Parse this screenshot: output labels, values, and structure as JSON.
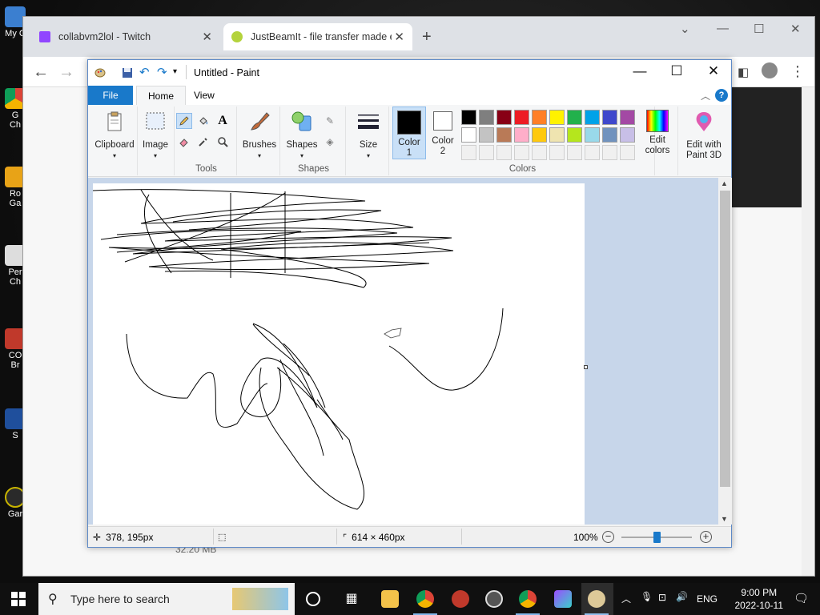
{
  "desktop": {
    "icons": [
      {
        "label": "My C"
      },
      {
        "label": "G\nCh"
      },
      {
        "label": "Ro\nGa"
      },
      {
        "label": "Per\nCh"
      },
      {
        "label": "CO\nBr"
      },
      {
        "label": "S"
      },
      {
        "label": "Gar"
      }
    ]
  },
  "browser": {
    "tabs": [
      {
        "title": "collabvm2lol - Twitch",
        "active": false
      },
      {
        "title": "JustBeamIt - file transfer made e",
        "active": true
      }
    ],
    "background_file_size": "32.20 MB"
  },
  "paint": {
    "title": "Untitled - Paint",
    "ribbon_tabs": [
      "File",
      "Home",
      "View"
    ],
    "groups": {
      "clipboard": "Clipboard",
      "image": "Image",
      "tools": "Tools",
      "brushes": "Brushes",
      "shapes": "Shapes",
      "shapes_group": "Shapes",
      "size": "Size",
      "color1": "Color\n1",
      "color2": "Color\n2",
      "colors_group": "Colors",
      "edit_colors": "Edit\ncolors",
      "edit_3d": "Edit with\nPaint 3D"
    },
    "color1": "#000000",
    "color2": "#ffffff",
    "palette_row1": [
      "#000000",
      "#7f7f7f",
      "#880015",
      "#ed1c24",
      "#ff7f27",
      "#fff200",
      "#22b14c",
      "#00a2e8",
      "#3f48cc",
      "#a349a4"
    ],
    "palette_row2": [
      "#ffffff",
      "#c3c3c3",
      "#b97a57",
      "#ffaec9",
      "#ffc90e",
      "#efe4b0",
      "#b5e61d",
      "#99d9ea",
      "#7092be",
      "#c8bfe7"
    ],
    "status": {
      "cursor_pos": "378, 195px",
      "canvas_size": "614 × 460px",
      "zoom": "100%",
      "zoom_fraction": 0.5
    }
  },
  "taskbar": {
    "search_placeholder": "Type here to search",
    "language": "ENG",
    "time": "9:00 PM",
    "date": "2022-10-11"
  }
}
